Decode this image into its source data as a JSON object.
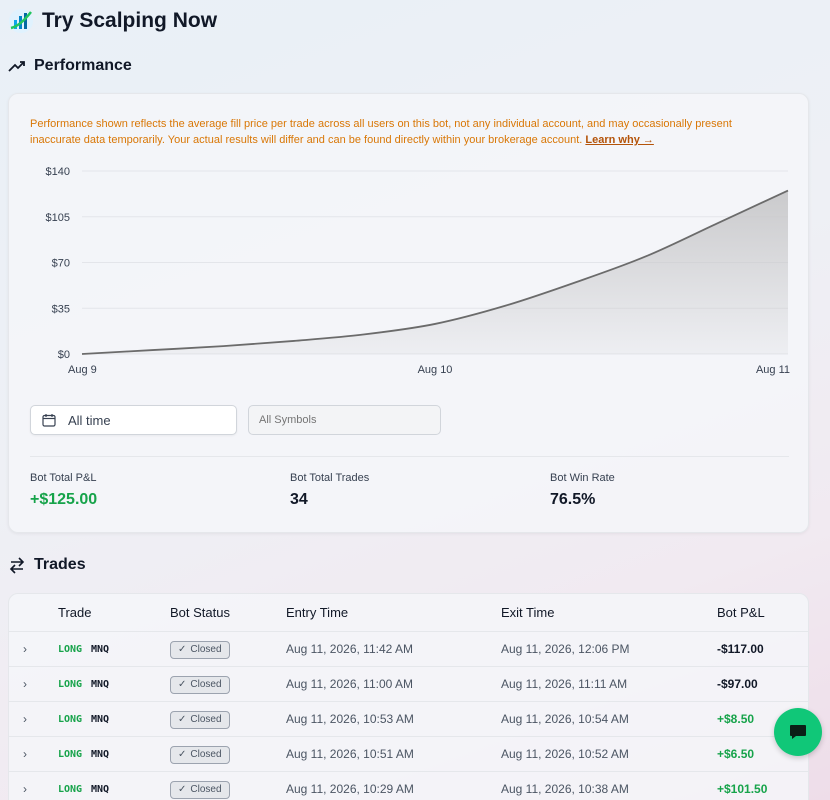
{
  "app": {
    "title": "Try Scalping Now"
  },
  "performance": {
    "heading": "Performance",
    "disclaimer": "Performance shown reflects the average fill price per trade across all users on this bot, not any individual account, and may occasionally present inaccurate data temporarily. Your actual results will differ and can be found directly within your brokerage account.",
    "learn_link": "Learn why →"
  },
  "chart_data": {
    "type": "area",
    "x_tick_labels": [
      "Aug 9",
      "Aug 10",
      "Aug 11"
    ],
    "y_tick_labels": [
      "$140",
      "$105",
      "$70",
      "$35",
      "$0"
    ],
    "y_ticks": [
      140,
      105,
      70,
      35,
      0
    ],
    "ylim": [
      0,
      140
    ],
    "grid": true,
    "series": [
      {
        "x": [
          0,
          0.1,
          0.2,
          0.3,
          0.4,
          0.5,
          0.6,
          0.7,
          0.8,
          0.9,
          1.0
        ],
        "y": [
          0,
          3,
          6,
          10,
          15,
          23,
          37,
          55,
          75,
          100,
          125
        ]
      }
    ],
    "line_color": "#6b6b6b",
    "fill_color": "#c8c8ca"
  },
  "filters": {
    "date_range": "All time",
    "symbol_placeholder": "All Symbols"
  },
  "stats": {
    "total_pnl_label": "Bot Total P&L",
    "total_pnl_value": "+$125.00",
    "total_trades_label": "Bot Total Trades",
    "total_trades_value": "34",
    "win_rate_label": "Bot Win Rate",
    "win_rate_value": "76.5%"
  },
  "trades": {
    "heading": "Trades",
    "columns": [
      "Trade",
      "Bot Status",
      "Entry Time",
      "Exit Time",
      "Bot P&L"
    ],
    "rows": [
      {
        "direction": "LONG",
        "symbol": "MNQ",
        "status": "Closed",
        "entry": "Aug 11, 2026, 11:42 AM",
        "exit": "Aug 11, 2026, 12:06 PM",
        "pnl": "-$117.00"
      },
      {
        "direction": "LONG",
        "symbol": "MNQ",
        "status": "Closed",
        "entry": "Aug 11, 2026, 11:00 AM",
        "exit": "Aug 11, 2026, 11:11 AM",
        "pnl": "-$97.00"
      },
      {
        "direction": "LONG",
        "symbol": "MNQ",
        "status": "Closed",
        "entry": "Aug 11, 2026, 10:53 AM",
        "exit": "Aug 11, 2026, 10:54 AM",
        "pnl": "+$8.50"
      },
      {
        "direction": "LONG",
        "symbol": "MNQ",
        "status": "Closed",
        "entry": "Aug 11, 2026, 10:51 AM",
        "exit": "Aug 11, 2026, 10:52 AM",
        "pnl": "+$6.50"
      },
      {
        "direction": "LONG",
        "symbol": "MNQ",
        "status": "Closed",
        "entry": "Aug 11, 2026, 10:29 AM",
        "exit": "Aug 11, 2026, 10:38 AM",
        "pnl": "+$101.50"
      }
    ]
  },
  "icons": {
    "logo": "chart-logo-icon",
    "chat": "chat-bubble-icon"
  },
  "colors": {
    "positive": "#16a34a",
    "warning": "#d97706",
    "fab": "#10c778"
  }
}
